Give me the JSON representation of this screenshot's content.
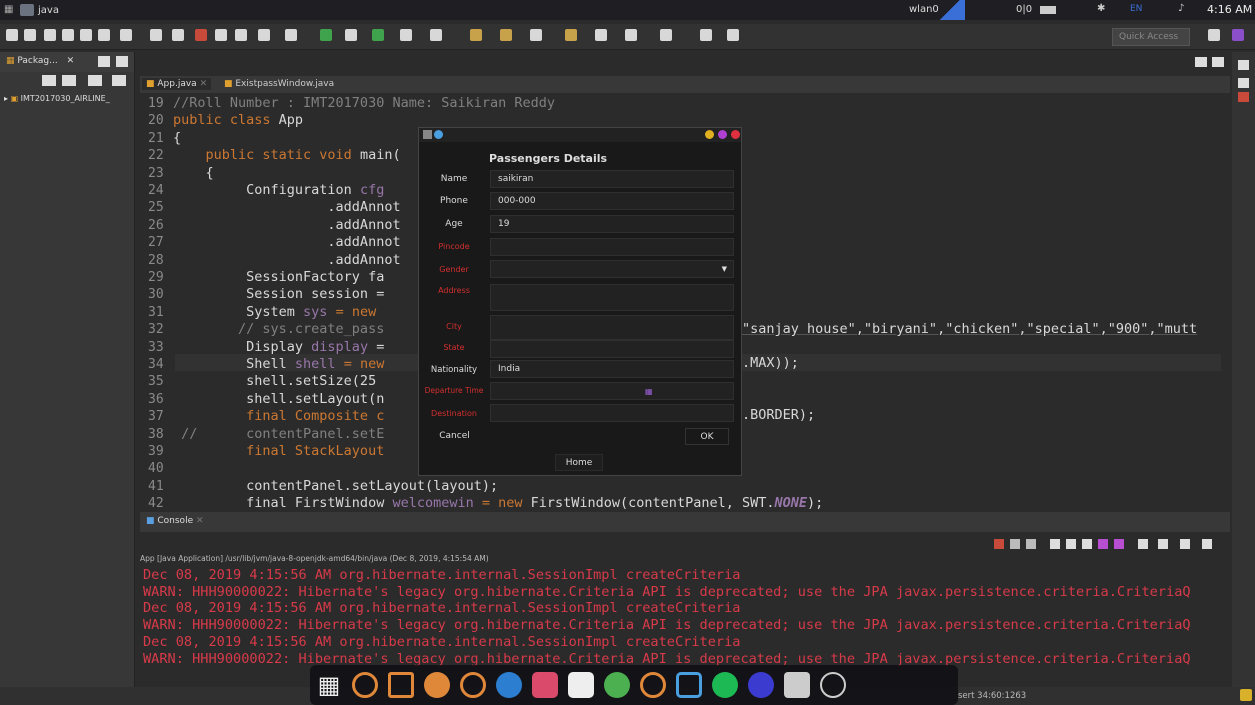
{
  "topbar": {
    "app_title": "java",
    "net": "wlan0",
    "counter": "0|0",
    "lang": "EN",
    "clock": "4:16 AM"
  },
  "toolbar": {
    "quick_access": "Quick Access"
  },
  "package_explorer": {
    "title": "Packag...",
    "project": "IMT2017030_AIRLINE_"
  },
  "editor": {
    "tabs": [
      "App.java",
      "ExistpassWindow.java"
    ],
    "lines": [
      {
        "n": "19",
        "segments": [
          {
            "t": "//Roll Number : IMT2017030 Name: Saikiran Reddy",
            "c": "cm"
          }
        ]
      },
      {
        "n": "20",
        "segments": [
          {
            "t": "public class ",
            "c": "kw"
          },
          {
            "t": "App",
            "c": ""
          }
        ]
      },
      {
        "n": "21",
        "segments": [
          {
            "t": "{",
            "c": ""
          }
        ]
      },
      {
        "n": "22",
        "segments": [
          {
            "t": "    public static void ",
            "c": "kw"
          },
          {
            "t": "main(",
            "c": ""
          }
        ]
      },
      {
        "n": "23",
        "segments": [
          {
            "t": "    {",
            "c": ""
          }
        ]
      },
      {
        "n": "24",
        "segments": [
          {
            "t": "         Configuration ",
            "c": ""
          },
          {
            "t": "cfg",
            "c": "fld"
          }
        ]
      },
      {
        "n": "25",
        "segments": [
          {
            "t": "                   .addAnnot",
            "c": ""
          }
        ]
      },
      {
        "n": "26",
        "segments": [
          {
            "t": "                   .addAnnot",
            "c": ""
          }
        ]
      },
      {
        "n": "27",
        "segments": [
          {
            "t": "                   .addAnnot",
            "c": ""
          }
        ]
      },
      {
        "n": "28",
        "segments": [
          {
            "t": "                   .addAnnot",
            "c": ""
          }
        ]
      },
      {
        "n": "29",
        "segments": [
          {
            "t": "         SessionFactory fa",
            "c": ""
          }
        ]
      },
      {
        "n": "30",
        "segments": [
          {
            "t": "         Session session =",
            "c": ""
          }
        ]
      },
      {
        "n": "31",
        "segments": [
          {
            "t": "         System ",
            "c": ""
          },
          {
            "t": "sys",
            "c": "fld"
          },
          {
            "t": " = new",
            "c": "kw"
          }
        ]
      },
      {
        "n": "32",
        "segments": [
          {
            "t": "        // sys.create_pass",
            "c": "cm"
          }
        ]
      },
      {
        "n": "33",
        "segments": [
          {
            "t": "         Display ",
            "c": ""
          },
          {
            "t": "display",
            "c": "fld"
          },
          {
            "t": " =",
            "c": ""
          }
        ]
      },
      {
        "n": "34",
        "segments": [
          {
            "t": "         Shell ",
            "c": ""
          },
          {
            "t": "shell",
            "c": "fld"
          },
          {
            "t": " = new",
            "c": "kw"
          }
        ]
      },
      {
        "n": "35",
        "segments": [
          {
            "t": "         shell.setSize(25",
            "c": ""
          }
        ]
      },
      {
        "n": "36",
        "segments": [
          {
            "t": "         shell.setLayout(n",
            "c": ""
          }
        ]
      },
      {
        "n": "37",
        "segments": [
          {
            "t": "         final Composite c",
            "c": "kw"
          }
        ]
      },
      {
        "n": "38",
        "segments": [
          {
            "t": " //      contentPanel.setE",
            "c": "cm"
          }
        ]
      },
      {
        "n": "39",
        "segments": [
          {
            "t": "         final StackLayout",
            "c": "kw"
          }
        ]
      },
      {
        "n": "40",
        "segments": [
          {
            "t": "",
            "c": ""
          }
        ]
      },
      {
        "n": "41",
        "segments": [
          {
            "t": "         contentPanel.setLayout(layout);",
            "c": ""
          }
        ]
      },
      {
        "n": "42",
        "segments": [
          {
            "t": "         final FirstWindow ",
            "c": ""
          },
          {
            "t": "welcomewin",
            "c": "fld"
          },
          {
            "t": " = new ",
            "c": "kw"
          },
          {
            "t": "FirstWindow(contentPanel, ",
            "c": ""
          },
          {
            "t": "SWT.",
            "c": ""
          },
          {
            "t": "NONE",
            "c": "st"
          },
          {
            "t": ");",
            "c": ""
          }
        ]
      }
    ],
    "right_fragments": {
      "l32": "\"sanjay house\",\"biryani\",\"chicken\",\"special\",\"900\",\"mutt",
      "l34": ".MAX));",
      "l37": ".BORDER);"
    }
  },
  "console": {
    "tab": "Console",
    "header": "App [Java Application] /usr/lib/jvm/java-8-openjdk-amd64/bin/java (Dec 8, 2019, 4:15:54 AM)",
    "lines": [
      "Dec 08, 2019 4:15:56 AM org.hibernate.internal.SessionImpl createCriteria",
      "WARN: HHH90000022: Hibernate's legacy org.hibernate.Criteria API is deprecated; use the JPA javax.persistence.criteria.CriteriaQ",
      "Dec 08, 2019 4:15:56 AM org.hibernate.internal.SessionImpl createCriteria",
      "WARN: HHH90000022: Hibernate's legacy org.hibernate.Criteria API is deprecated; use the JPA javax.persistence.criteria.CriteriaQ",
      "Dec 08, 2019 4:15:56 AM org.hibernate.internal.SessionImpl createCriteria",
      "WARN: HHH90000022: Hibernate's legacy org.hibernate.Criteria API is deprecated; use the JPA javax.persistence.criteria.CriteriaQ"
    ]
  },
  "status": {
    "position": "sert  34:60:1263"
  },
  "dialog": {
    "title": "Passengers Details",
    "fields": {
      "name_label": "Name",
      "name_value": "saikiran",
      "phone_label": "Phone",
      "phone_value": "000-000",
      "age_label": "Age",
      "age_value": "19",
      "pincode_label": "Pincode",
      "gender_label": "Gender",
      "address_label": "Address",
      "city_label": "City",
      "state_label": "State",
      "nationality_label": "Nationality",
      "nationality_value": "India",
      "departure_label": "Departure Time",
      "destination_label": "Destination"
    },
    "cancel": "Cancel",
    "ok": "OK",
    "home": "Home"
  },
  "colors": {
    "error_red": "#d73a49",
    "keyword": "#cc7832",
    "field": "#9876aa"
  }
}
